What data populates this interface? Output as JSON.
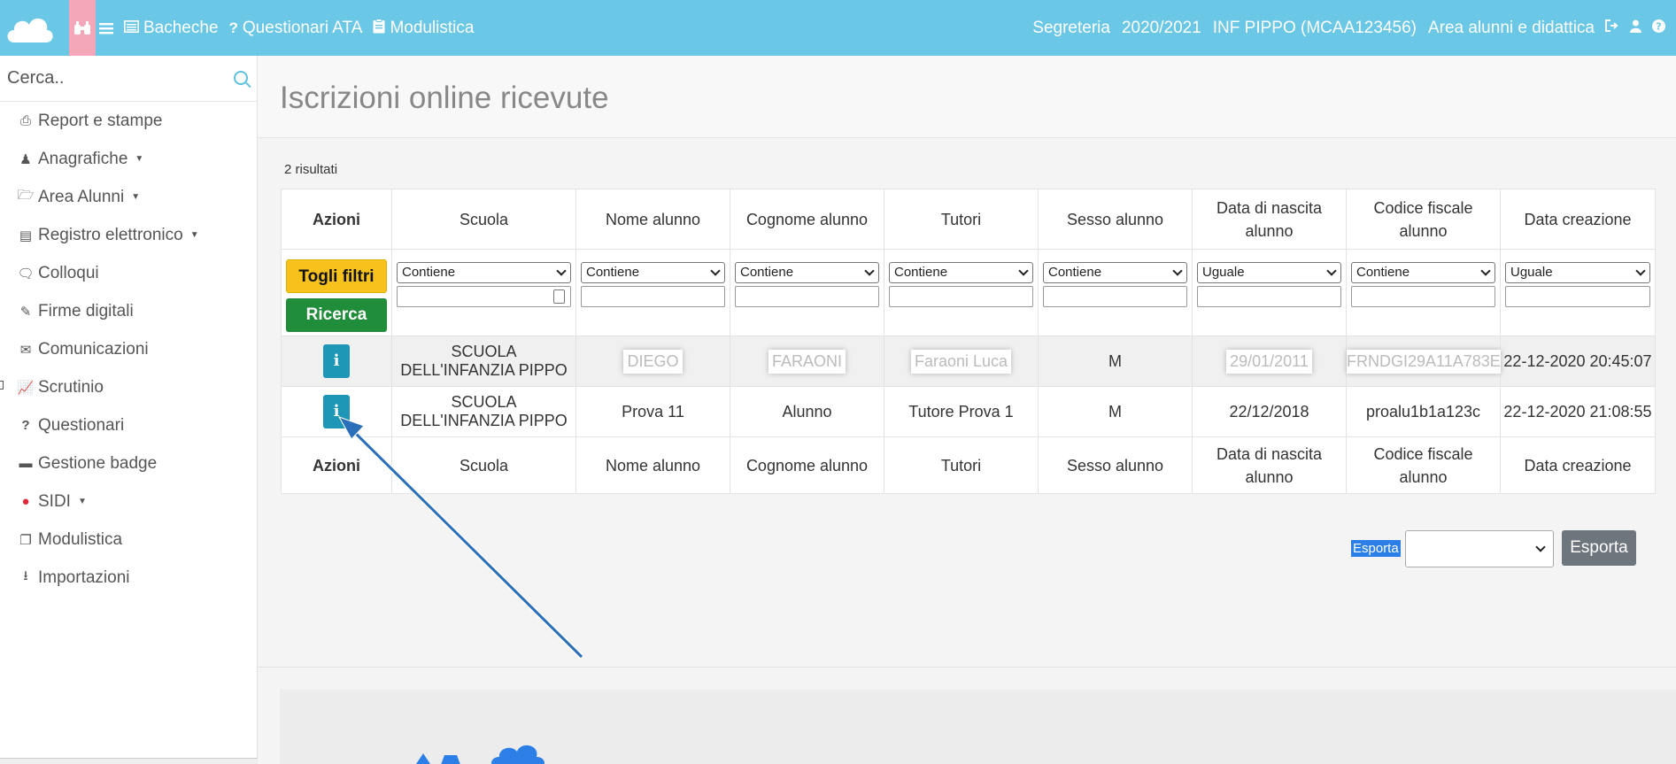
{
  "topbar": {
    "links": [
      {
        "label": "Bacheche",
        "icon": "list-alt-icon"
      },
      {
        "label": "Questionari ATA",
        "icon": "question-icon"
      },
      {
        "label": "Modulistica",
        "icon": "clipboard-icon"
      }
    ],
    "right": {
      "role": "Segreteria",
      "year": "2020/2021",
      "school": "INF PIPPO (MCAA123456)",
      "area": "Area alunni e didattica"
    }
  },
  "sidebar": {
    "search_placeholder": "Cerca..",
    "items": [
      {
        "label": "Report e stampe",
        "icon": "print-icon",
        "caret": false
      },
      {
        "label": "Anagrafiche",
        "icon": "users-icon",
        "caret": true
      },
      {
        "label": "Area Alunni",
        "icon": "folder-open-icon",
        "caret": true
      },
      {
        "label": "Registro elettronico",
        "icon": "book-icon",
        "caret": true
      },
      {
        "label": "Colloqui",
        "icon": "comments-icon",
        "caret": false
      },
      {
        "label": "Firme digitali",
        "icon": "pencil-icon",
        "caret": false
      },
      {
        "label": "Comunicazioni",
        "icon": "envelope-icon",
        "caret": false
      },
      {
        "label": "Scrutinio",
        "icon": "line-chart-icon",
        "caret": false
      },
      {
        "label": "Questionari",
        "icon": "question-icon",
        "caret": false
      },
      {
        "label": "Gestione badge",
        "icon": "credit-card-icon",
        "caret": false
      },
      {
        "label": "SIDI",
        "icon": "exclamation-circle-icon",
        "caret": true
      },
      {
        "label": "Modulistica",
        "icon": "copy-icon",
        "caret": false
      },
      {
        "label": "Importazioni",
        "icon": "upload-icon",
        "caret": false
      }
    ]
  },
  "main": {
    "title": "Iscrizioni online ricevute",
    "results": "2 risultati",
    "columns": [
      "Azioni",
      "Scuola",
      "Nome alunno",
      "Cognome alunno",
      "Tutori",
      "Sesso alunno",
      "Data di nascita alunno",
      "Codice fiscale alunno",
      "Data creazione"
    ],
    "filters": {
      "clear_label": "Togli filtri",
      "search_label": "Ricerca",
      "operators": [
        "Contiene",
        "Contiene",
        "Contiene",
        "Contiene",
        "Contiene",
        "Uguale",
        "Contiene",
        "Uguale"
      ]
    },
    "rows": [
      {
        "scuola": "SCUOLA DELL'INFANZIA PIPPO",
        "nome": "DIEGO",
        "cognome": "FARAONI",
        "tutori": "Faraoni Luca",
        "sesso": "M",
        "nascita": "29/01/2011",
        "cf": "FRNDGI29A11A783E",
        "creazione": "22-12-2020 20:45:07"
      },
      {
        "scuola": "SCUOLA DELL'INFANZIA PIPPO",
        "nome": "Prova 11",
        "cognome": "Alunno",
        "tutori": "Tutore Prova 1",
        "sesso": "M",
        "nascita": "22/12/2018",
        "cf": "proalu1b1a123c",
        "creazione": "22-12-2020 21:08:55"
      }
    ],
    "info_glyph": "i",
    "export": {
      "label": "Esporta",
      "button": "Esporta"
    }
  },
  "colors": {
    "navbar": "#6bc7e6",
    "accent_pink": "#f4a7b9",
    "info": "#1d97b5",
    "warning": "#f7c21c",
    "success": "#1f8d3a"
  }
}
